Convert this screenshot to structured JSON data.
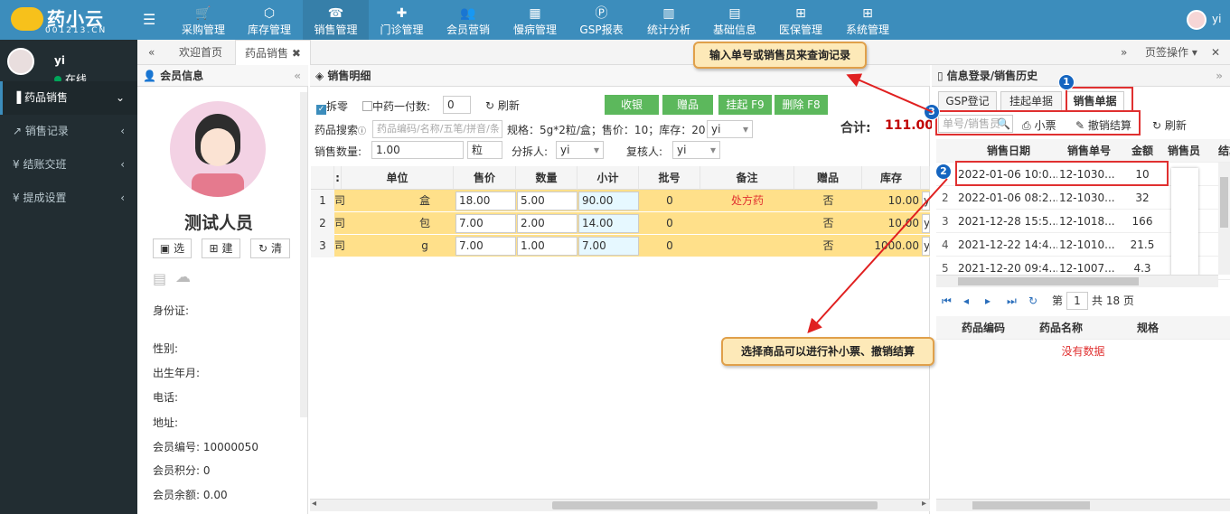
{
  "app": {
    "logo_text": "药小云",
    "logo_sub": "001213.CN",
    "user": "yi"
  },
  "topnav": [
    {
      "label": "采购管理",
      "icon": "cart-icon"
    },
    {
      "label": "库存管理",
      "icon": "cube-icon"
    },
    {
      "label": "销售管理",
      "icon": "register-icon"
    },
    {
      "label": "门诊管理",
      "icon": "medkit-icon"
    },
    {
      "label": "会员营销",
      "icon": "users-icon"
    },
    {
      "label": "慢病管理",
      "icon": "hospital-icon"
    },
    {
      "label": "GSP报表",
      "icon": "p-icon"
    },
    {
      "label": "统计分析",
      "icon": "bar-chart-icon"
    },
    {
      "label": "基础信息",
      "icon": "book-icon"
    },
    {
      "label": "医保管理",
      "icon": "windows-icon"
    },
    {
      "label": "系统管理",
      "icon": "windows-icon"
    }
  ],
  "sidebar": {
    "user": "yi",
    "status": "在线",
    "items": [
      {
        "label": "药品销售",
        "icon": "pill-icon"
      },
      {
        "label": "销售记录",
        "icon": "chart-icon"
      },
      {
        "label": "结账交班",
        "icon": "yen-icon"
      },
      {
        "label": "提成设置",
        "icon": "yen-icon"
      }
    ]
  },
  "tabs": {
    "home": "欢迎首页",
    "sales": "药品销售",
    "ops": "页签操作"
  },
  "member": {
    "header": "会员信息",
    "name": "测试人员",
    "btn_select": "选",
    "btn_create": "建",
    "btn_clear": "清",
    "id_label": "身份证:",
    "gender_label": "性别:",
    "birth_label": "出生年月:",
    "phone_label": "电话:",
    "address_label": "地址:",
    "number_label": "会员编号:",
    "number": "10000050",
    "points_label": "会员积分:",
    "points": "0",
    "balance_label": "会员余额:",
    "balance": "0.00"
  },
  "sales": {
    "header": "销售明细",
    "split_label": "拆零",
    "herb_label": "中药一付数:",
    "herb_value": "0",
    "refresh": "刷新",
    "btn_checkout": "收银",
    "btn_gift": "赠品",
    "btn_hold": "挂起 F9",
    "btn_delete": "删除 F8",
    "search_label": "药品搜索",
    "search_placeholder": "药品编码/名称/五笔/拼音/条",
    "spec_text": "规格：5g*2粒/盒；售价：10；库存：20",
    "spec_select": "yi",
    "qty_label": "销售数量:",
    "qty_value": "1.00",
    "unit_value": "粒",
    "splitter_label": "分拆人:",
    "splitter_value": "yi",
    "checker_label": "复核人:",
    "checker_value": "yi",
    "total_label": "合计:",
    "total_value": "111.00",
    "columns": [
      "单位",
      "售价",
      "数量",
      "小计",
      "批号",
      "备注",
      "赠品",
      "库存"
    ],
    "rows": [
      {
        "no": "1",
        "mfr": "司",
        "unit": "盒",
        "price": "18.00",
        "qty": "5.00",
        "subtotal": "90.00",
        "batch": "0",
        "note": "处方药",
        "gift": "否",
        "stock": "10.00",
        "extra": "y"
      },
      {
        "no": "2",
        "mfr": "司",
        "unit": "包",
        "price": "7.00",
        "qty": "2.00",
        "subtotal": "14.00",
        "batch": "0",
        "note": "",
        "gift": "否",
        "stock": "10.00",
        "extra": "y"
      },
      {
        "no": "3",
        "mfr": "司",
        "unit": "g",
        "price": "7.00",
        "qty": "1.00",
        "subtotal": "7.00",
        "batch": "0",
        "note": "",
        "gift": "否",
        "stock": "1000.00",
        "extra": "y"
      }
    ]
  },
  "history": {
    "header": "信息登录/销售历史",
    "tab_gsp": "GSP登记",
    "tab_hold": "挂起单据",
    "tab_sales": "销售单据",
    "search_placeholder": "单号/销售员",
    "btn_ticket": "小票",
    "btn_cancel": "撤销结算",
    "btn_refresh": "刷新",
    "columns": [
      "销售日期",
      "销售单号",
      "金额",
      "销售员",
      "结算"
    ],
    "rows": [
      {
        "no": "1",
        "date": "2022-01-06 10:0...",
        "order": "12-1030...",
        "amount": "10"
      },
      {
        "no": "2",
        "date": "2022-01-06 08:2...",
        "order": "12-1030...",
        "amount": "32"
      },
      {
        "no": "3",
        "date": "2021-12-28 15:5...",
        "order": "12-1018...",
        "amount": "166"
      },
      {
        "no": "4",
        "date": "2021-12-22 14:4...",
        "order": "12-1010...",
        "amount": "21.5"
      },
      {
        "no": "5",
        "date": "2021-12-20 09:4...",
        "order": "12-1007...",
        "amount": "4.3"
      }
    ],
    "page_prefix": "第",
    "page_value": "1",
    "page_suffix": "共 18 页",
    "detail_columns": [
      "药品编码",
      "药品名称",
      "规格"
    ],
    "no_data": "没有数据"
  },
  "annotations": {
    "callout_top": "输入单号或销售员来查询记录",
    "callout_bottom": "选择商品可以进行补小票、撤销结算",
    "badge1": "1",
    "badge2": "2",
    "badge3": "3",
    "color_callout": "#fde9b8",
    "color_arrow": "#e02020"
  },
  "colors": {
    "topnav": "#3c8dbc",
    "sidebar": "#222d32",
    "green_button": "#5cb85c",
    "row_highlight": "#ffe08a",
    "total_red": "#c00000"
  }
}
